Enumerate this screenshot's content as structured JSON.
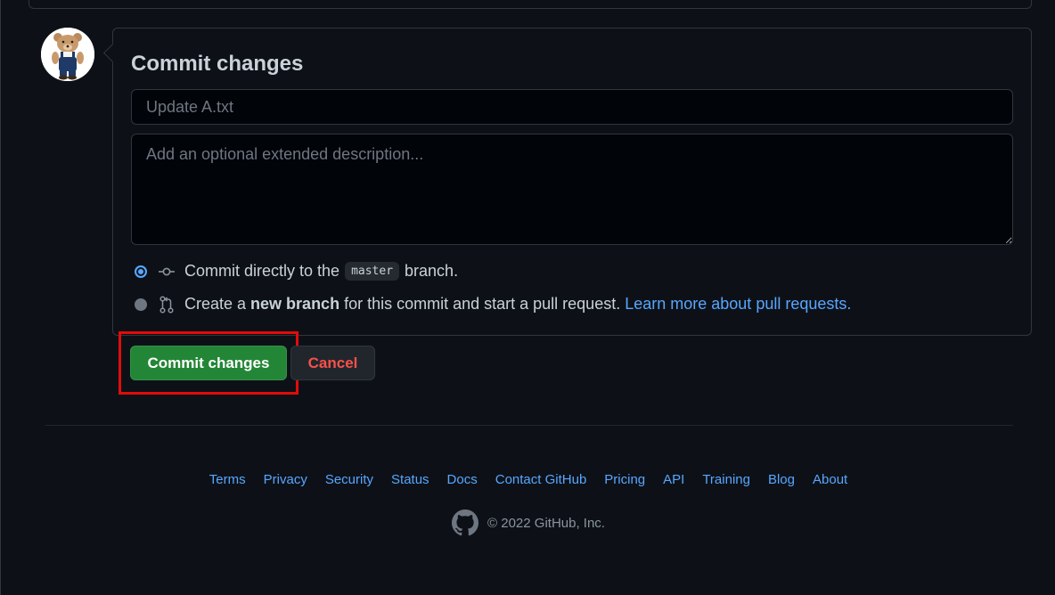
{
  "commit_form": {
    "title": "Commit changes",
    "summary_placeholder": "Update A.txt",
    "description_placeholder": "Add an optional extended description...",
    "option_direct": {
      "text_before": "Commit directly to the",
      "branch": "master",
      "text_after": "branch.",
      "selected": true
    },
    "option_new_branch": {
      "text_before": "Create a",
      "bold": "new branch",
      "text_after": "for this commit and start a pull request.",
      "link": "Learn more about pull requests.",
      "selected": false
    },
    "commit_button": "Commit changes",
    "cancel_button": "Cancel"
  },
  "footer": {
    "links": [
      "Terms",
      "Privacy",
      "Security",
      "Status",
      "Docs",
      "Contact GitHub",
      "Pricing",
      "API",
      "Training",
      "Blog",
      "About"
    ],
    "copyright": "© 2022 GitHub, Inc."
  },
  "colors": {
    "background": "#0d1117",
    "border": "#30363d",
    "accent_link": "#58a6ff",
    "commit_green": "#238636",
    "cancel_red": "#f85149",
    "highlight_red": "#e10b0b"
  },
  "icons": {
    "avatar": "teddy-bear-avatar",
    "commit": "git-commit-icon",
    "pull_request": "git-pull-request-icon",
    "logo": "github-mark-icon"
  }
}
